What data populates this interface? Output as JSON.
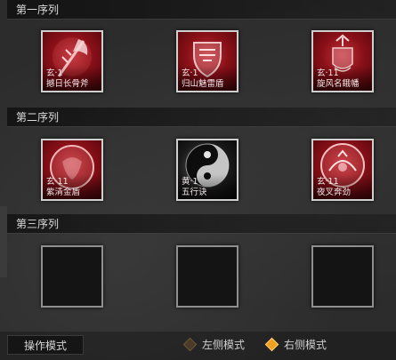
{
  "sections": [
    {
      "title": "第一序列",
      "slots": [
        {
          "grade": "玄·1",
          "name": "撼日长骨斧",
          "style": "red",
          "icon": "axe-icon"
        },
        {
          "grade": "玄·1",
          "name": "归山魅雷盾",
          "style": "red",
          "icon": "shield-icon"
        },
        {
          "grade": "玄·11",
          "name": "旋风名鋨幡",
          "style": "red",
          "icon": "banner-icon"
        }
      ]
    },
    {
      "title": "第二序列",
      "slots": [
        {
          "grade": "玄·11",
          "name": "紫清金盾",
          "style": "red",
          "icon": "orb-shield-icon"
        },
        {
          "grade": "黄·1",
          "name": "五行诀",
          "style": "blackwhite",
          "icon": "yin-yang-icon"
        },
        {
          "grade": "玄·11",
          "name": "夜叉奔劲",
          "style": "red",
          "icon": "demon-orb-icon"
        }
      ]
    },
    {
      "title": "第三序列",
      "slots": [
        {
          "grade": "",
          "name": "",
          "style": "empty",
          "icon": ""
        },
        {
          "grade": "",
          "name": "",
          "style": "empty",
          "icon": ""
        },
        {
          "grade": "",
          "name": "",
          "style": "empty",
          "icon": ""
        }
      ]
    }
  ],
  "footer": {
    "mode_label": "操作模式",
    "left_mode": "左侧模式",
    "right_mode": "右侧模式",
    "selected": "right"
  },
  "colors": {
    "accent": "#f0a020",
    "slot_red": "#8a1018"
  }
}
